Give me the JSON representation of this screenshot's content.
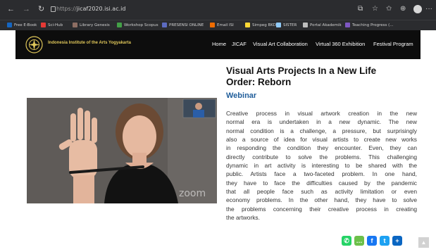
{
  "browser": {
    "url_prefix": "https://",
    "url_host": "jicaf2020.isi.ac.id",
    "icons": [
      "back-icon",
      "forward-icon",
      "reload-icon",
      "lock-icon",
      "translate-icon",
      "extension-icon",
      "favorites-icon",
      "collections-icon",
      "profile-icon",
      "more-icon"
    ],
    "back": "←",
    "forward": "→",
    "reload": "↻",
    "more": "···",
    "bookmarks": [
      {
        "label": "Free E-Book",
        "color": "#1565c0"
      },
      {
        "label": "Sci-Hub",
        "color": "#e53935"
      },
      {
        "label": "Library Genesis",
        "color": "#8d6e63"
      },
      {
        "label": "Workshop Scopus",
        "color": "#43a047"
      },
      {
        "label": "PRESENSI ONLINE",
        "color": "#5c6bc0"
      },
      {
        "label": "Email ISI",
        "color": "#ef6c00"
      },
      {
        "label": "Simpeg BKD",
        "color": "#fdd835"
      },
      {
        "label": "SISTER",
        "color": "#90caf9"
      },
      {
        "label": "Portal Akademik",
        "color": "#bdbdbd"
      },
      {
        "label": "Teaching Progress (...",
        "color": "#7e57c2"
      }
    ]
  },
  "site": {
    "brand": "Indonesia Institute of the Arts Yogyakarta",
    "menu": [
      "Home",
      "JICAF",
      "Visual Art Collaboration",
      "Virtual 360 Exhibition",
      "Festival Program"
    ],
    "accent": "#e0c75a",
    "header_bg": "#0d0d0d"
  },
  "article": {
    "title_line1": "Visual Arts Projects In a New Life",
    "title_line2": "Order: Reborn",
    "subtitle": "Webinar",
    "subtitle_color": "#1f5d9a",
    "lines": [
      "Creative process in visual artwork creation in the new",
      "normal era is undertaken in a new dynamic. The new",
      "normal condition is a challenge, a pressure, but surprisingly",
      "also a source of idea for visual artists to create new works",
      "in responding the condition they encounter. Even, they can",
      "directly contribute to solve the problems. This challenging",
      "dynamic in art activity is interesting to be shared with the",
      "public. Artists face a two-faceted problem. In one hand,",
      "they have to face the difficulties caused by the pandemic",
      "that all people face such as activity limitation or even",
      "economy problems. In the other hand, they have to solve",
      "the problems concerning their creative process in creating",
      "the artworks."
    ]
  },
  "video": {
    "watermark": "zoom"
  },
  "share": [
    {
      "name": "whatsapp-share-icon",
      "color": "#25d366",
      "glyph": "✆"
    },
    {
      "name": "sms-share-icon",
      "color": "#6cc04a",
      "glyph": "…"
    },
    {
      "name": "facebook-share-icon",
      "color": "#1877f2",
      "glyph": "f"
    },
    {
      "name": "twitter-share-icon",
      "color": "#1da1f2",
      "glyph": "t"
    },
    {
      "name": "more-share-icon",
      "color": "#0a66c2",
      "glyph": "+"
    }
  ],
  "scroll_top_glyph": "▲"
}
